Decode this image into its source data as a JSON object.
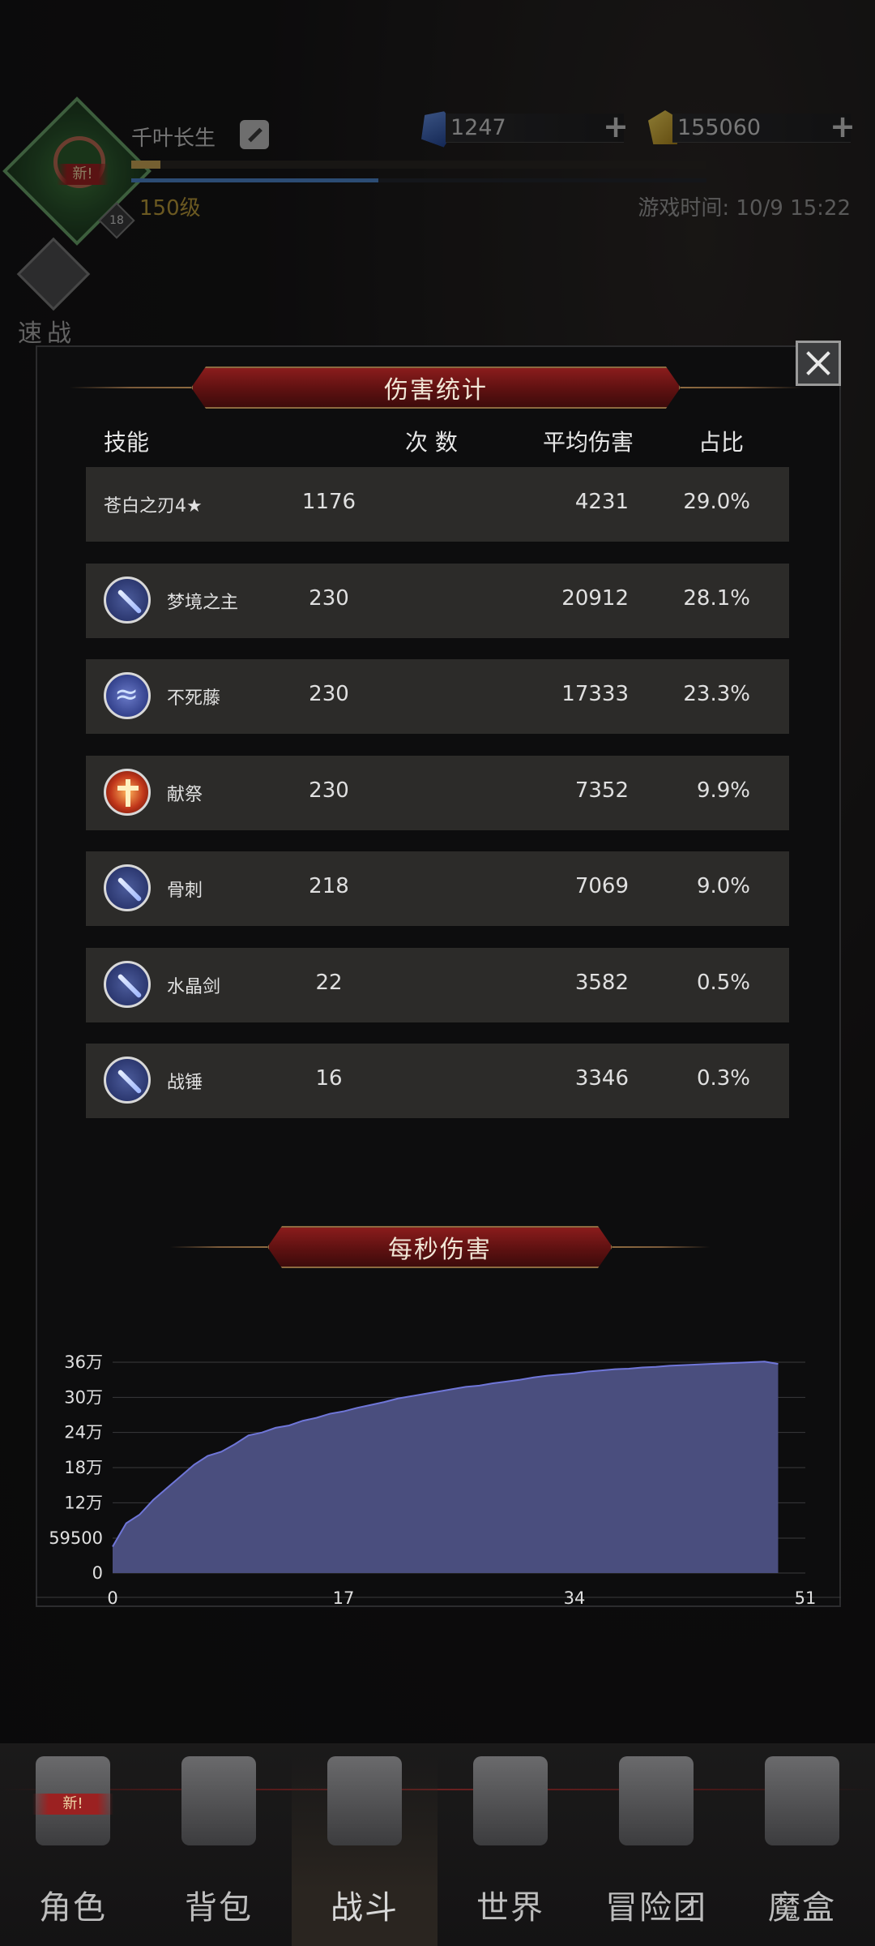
{
  "player": {
    "name": "千叶长生",
    "new_tag": "新!",
    "badge_level": "18",
    "level_text": "150级",
    "xp_progress": 0.05,
    "mp_progress": 0.43,
    "game_time": "游戏时间: 10/9 15:22"
  },
  "resources": {
    "gems": "1247",
    "gold": "155060",
    "plus": "+"
  },
  "quick_battle": {
    "label": "速战"
  },
  "modal": {
    "title": "伤害统计",
    "columns": [
      "技能",
      "次 数",
      "平均伤害",
      "占比"
    ],
    "rows": [
      {
        "name": "苍白之刃4★",
        "count": "1176",
        "avg": "4231",
        "pct": "29.0%",
        "icon": "none"
      },
      {
        "name": "梦境之主",
        "count": "230",
        "avg": "20912",
        "pct": "28.1%",
        "icon": "sword-icon"
      },
      {
        "name": "不死藤",
        "count": "230",
        "avg": "17333",
        "pct": "23.3%",
        "icon": "vine-icon"
      },
      {
        "name": "献祭",
        "count": "230",
        "avg": "7352",
        "pct": "9.9%",
        "icon": "cross-icon"
      },
      {
        "name": "骨刺",
        "count": "218",
        "avg": "7069",
        "pct": "9.0%",
        "icon": "sword-icon"
      },
      {
        "name": "水晶剑",
        "count": "22",
        "avg": "3582",
        "pct": "0.5%",
        "icon": "sword-icon"
      },
      {
        "name": "战锤",
        "count": "16",
        "avg": "3346",
        "pct": "0.3%",
        "icon": "sword-icon"
      }
    ],
    "chart_title": "每秒伤害"
  },
  "chart_data": {
    "type": "area",
    "title": "每秒伤害",
    "y_tick_labels": [
      "0",
      "59500",
      "12万",
      "18万",
      "24万",
      "30万",
      "36万"
    ],
    "y_ticks": [
      0,
      59500,
      120000,
      180000,
      240000,
      300000,
      360000
    ],
    "x_ticks": [
      0,
      17,
      34,
      51
    ],
    "xlim": [
      0,
      51
    ],
    "ylim": [
      0,
      360000
    ],
    "color": "#4a4e7e",
    "line_color": "#6f76d8",
    "x": [
      0,
      1,
      2,
      3,
      4,
      5,
      6,
      7,
      8,
      9,
      10,
      11,
      12,
      13,
      14,
      15,
      16,
      17,
      18,
      19,
      20,
      21,
      22,
      23,
      24,
      25,
      26,
      27,
      28,
      29,
      30,
      31,
      32,
      33,
      34,
      35,
      36,
      37,
      38,
      39,
      40,
      41,
      42,
      43,
      44,
      45,
      46,
      47,
      48,
      49
    ],
    "y": [
      45000,
      85000,
      100000,
      125000,
      145000,
      165000,
      185000,
      200000,
      207000,
      220000,
      235000,
      240000,
      248000,
      252000,
      260000,
      265000,
      272000,
      276000,
      282000,
      287000,
      292000,
      298000,
      302000,
      306000,
      310000,
      314000,
      318000,
      320000,
      324000,
      327000,
      330000,
      334000,
      337000,
      339000,
      341000,
      344000,
      346000,
      348000,
      349000,
      351000,
      352000,
      354000,
      355000,
      356000,
      357000,
      358000,
      359000,
      360000,
      361000,
      357000
    ],
    "grid": true
  },
  "nav": {
    "items": [
      {
        "label": "角色",
        "icon": "helmet-icon",
        "new": "新!"
      },
      {
        "label": "背包",
        "icon": "backpack-icon"
      },
      {
        "label": "战斗",
        "icon": "sword-shield-icon"
      },
      {
        "label": "世界",
        "icon": "map-icon"
      },
      {
        "label": "冒险团",
        "icon": "castle-icon"
      },
      {
        "label": "魔盒",
        "icon": "box-icon"
      }
    ]
  }
}
